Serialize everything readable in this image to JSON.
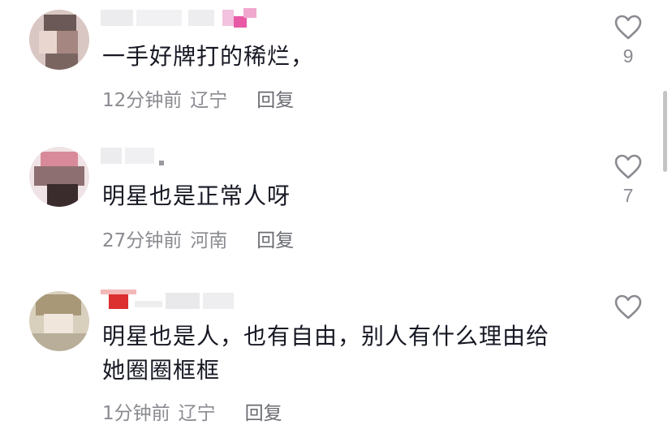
{
  "comments": [
    {
      "text_lines": [
        "一手好牌打的稀烂，"
      ],
      "time": "12分钟前",
      "location": "辽宁",
      "reply_label": "回复",
      "like_count": "9"
    },
    {
      "text_lines": [
        "明星也是正常人呀"
      ],
      "time": "27分钟前",
      "location": "河南",
      "reply_label": "回复",
      "like_count": "7"
    },
    {
      "text_lines": [
        "明星也是人，也有自由，别人有什么理由给",
        "她圈圈框框"
      ],
      "time": "1分钟前",
      "location": "辽宁",
      "reply_label": "回复",
      "like_count": ""
    }
  ],
  "colors": {
    "text": "#161823",
    "meta": "#8a8b91",
    "icon": "#8a8b91"
  },
  "icons": {
    "like": "heart-outline-icon"
  }
}
